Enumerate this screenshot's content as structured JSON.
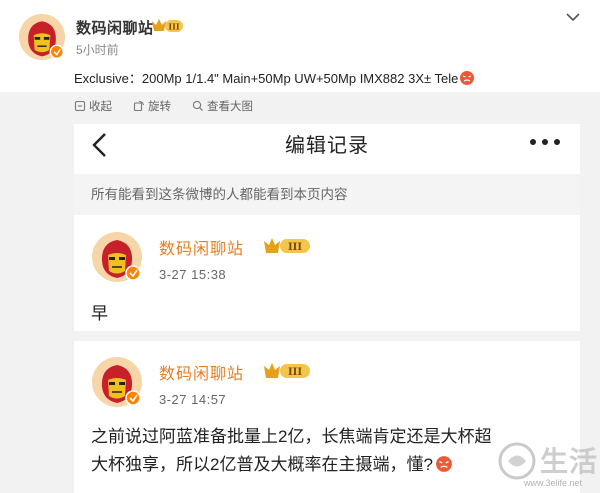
{
  "post": {
    "author_name": "数码闲聊站",
    "badge_level": "III",
    "time": "5小时前",
    "text": "Exclusive：200Mp 1/1.4\" Main+50Mp UW+50Mp IMX882 3X± Tele",
    "trailing_emoji": "crying-face-emoji"
  },
  "actions": {
    "favorite": "收起",
    "rotate": "旋转",
    "view_large": "查看大图"
  },
  "panel": {
    "title": "编辑记录",
    "notice": "所有能看到这条微博的人都能看到本页内容"
  },
  "entries": [
    {
      "name": "数码闲聊站",
      "badge_level": "III",
      "time": "3-27 15:38",
      "text": "早"
    },
    {
      "name": "数码闲聊站",
      "badge_level": "III",
      "time": "3-27 14:57",
      "text_line1": "之前说过阿蓝准备批量上2亿，长焦端肯定还是大杯超",
      "text_line2": "大杯独享，所以2亿普及大概率在主摄端，懂?"
    }
  ],
  "watermark": {
    "text": "生活",
    "url": "www.3elife.net"
  },
  "colors": {
    "name_orange": "#e67e22",
    "badge_gold": "#e4a11b",
    "verified_orange": "#ff8200",
    "background_grey": "#f2f2f2"
  }
}
